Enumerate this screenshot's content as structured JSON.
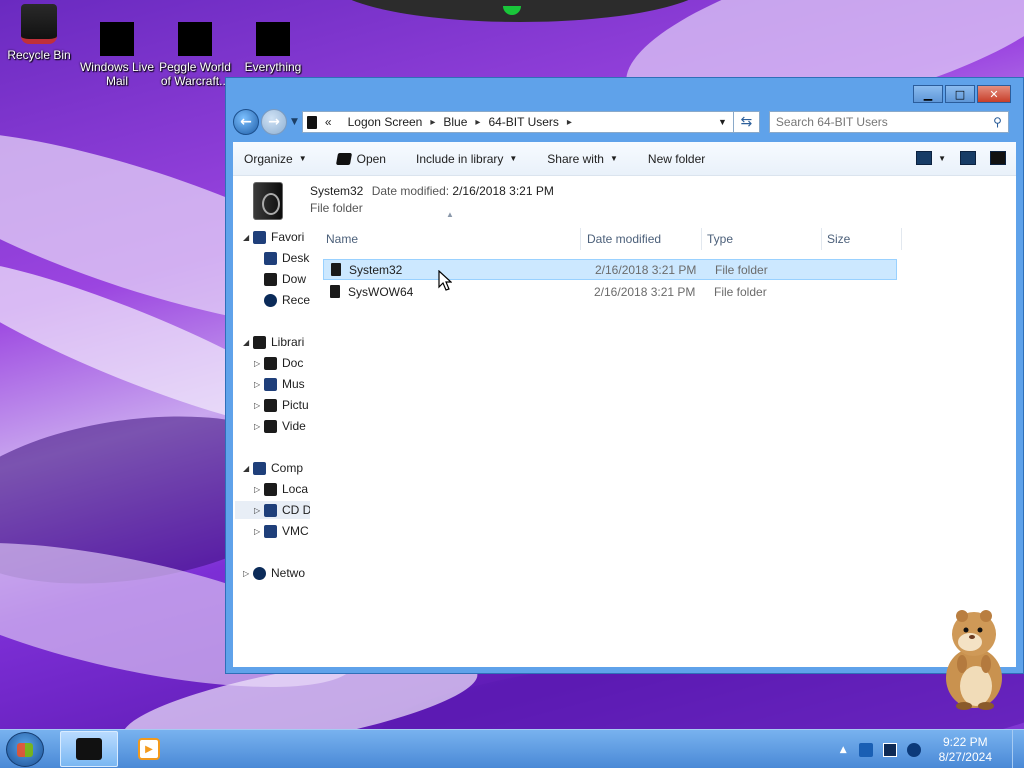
{
  "desktop": {
    "icons": [
      {
        "label": "Recycle Bin",
        "icon": "recycle-bin-icon"
      },
      {
        "label": "Windows Live Mail",
        "icon": "mail-icon"
      },
      {
        "label": "Peggle World of Warcraft...",
        "icon": "peggle-icon"
      },
      {
        "label": "Everything",
        "icon": "search-app-icon"
      }
    ]
  },
  "window": {
    "controls": {
      "minimize": "▁",
      "maximize": "□",
      "close": "✕"
    },
    "address": {
      "overflow": "«",
      "crumbs": [
        "Logon Screen",
        "Blue",
        "64-BIT Users"
      ]
    },
    "search": {
      "placeholder": "Search 64-BIT Users"
    },
    "toolbar": {
      "organize": "Organize",
      "open": "Open",
      "include": "Include in library",
      "share": "Share with",
      "new_folder": "New folder"
    },
    "details": {
      "name": "System32",
      "modified_label": "Date modified:",
      "modified_value": "2/16/2018 3:21 PM",
      "type": "File folder"
    },
    "nav": [
      {
        "label": "Favorites",
        "visible": "Favori"
      },
      {
        "label": "Desktop",
        "visible": "Desk"
      },
      {
        "label": "Downloads",
        "visible": "Dow"
      },
      {
        "label": "Recent Places",
        "visible": "Rece"
      },
      {
        "label": "Libraries",
        "visible": "Librari"
      },
      {
        "label": "Documents",
        "visible": "Doc"
      },
      {
        "label": "Music",
        "visible": "Mus"
      },
      {
        "label": "Pictures",
        "visible": "Pictu"
      },
      {
        "label": "Videos",
        "visible": "Vide"
      },
      {
        "label": "Computer",
        "visible": "Comp"
      },
      {
        "label": "Local Disk",
        "visible": "Loca"
      },
      {
        "label": "CD Drive",
        "visible": "CD D"
      },
      {
        "label": "VMC",
        "visible": "VMC"
      },
      {
        "label": "Network",
        "visible": "Netwo"
      }
    ],
    "columns": {
      "name": "Name",
      "date": "Date modified",
      "type": "Type",
      "size": "Size"
    },
    "rows": [
      {
        "name": "System32",
        "date": "2/16/2018 3:21 PM",
        "type": "File folder",
        "size": ""
      },
      {
        "name": "SysWOW64",
        "date": "2/16/2018 3:21 PM",
        "type": "File folder",
        "size": ""
      }
    ]
  },
  "taskbar": {
    "time": "9:22 PM",
    "date": "8/27/2024"
  }
}
